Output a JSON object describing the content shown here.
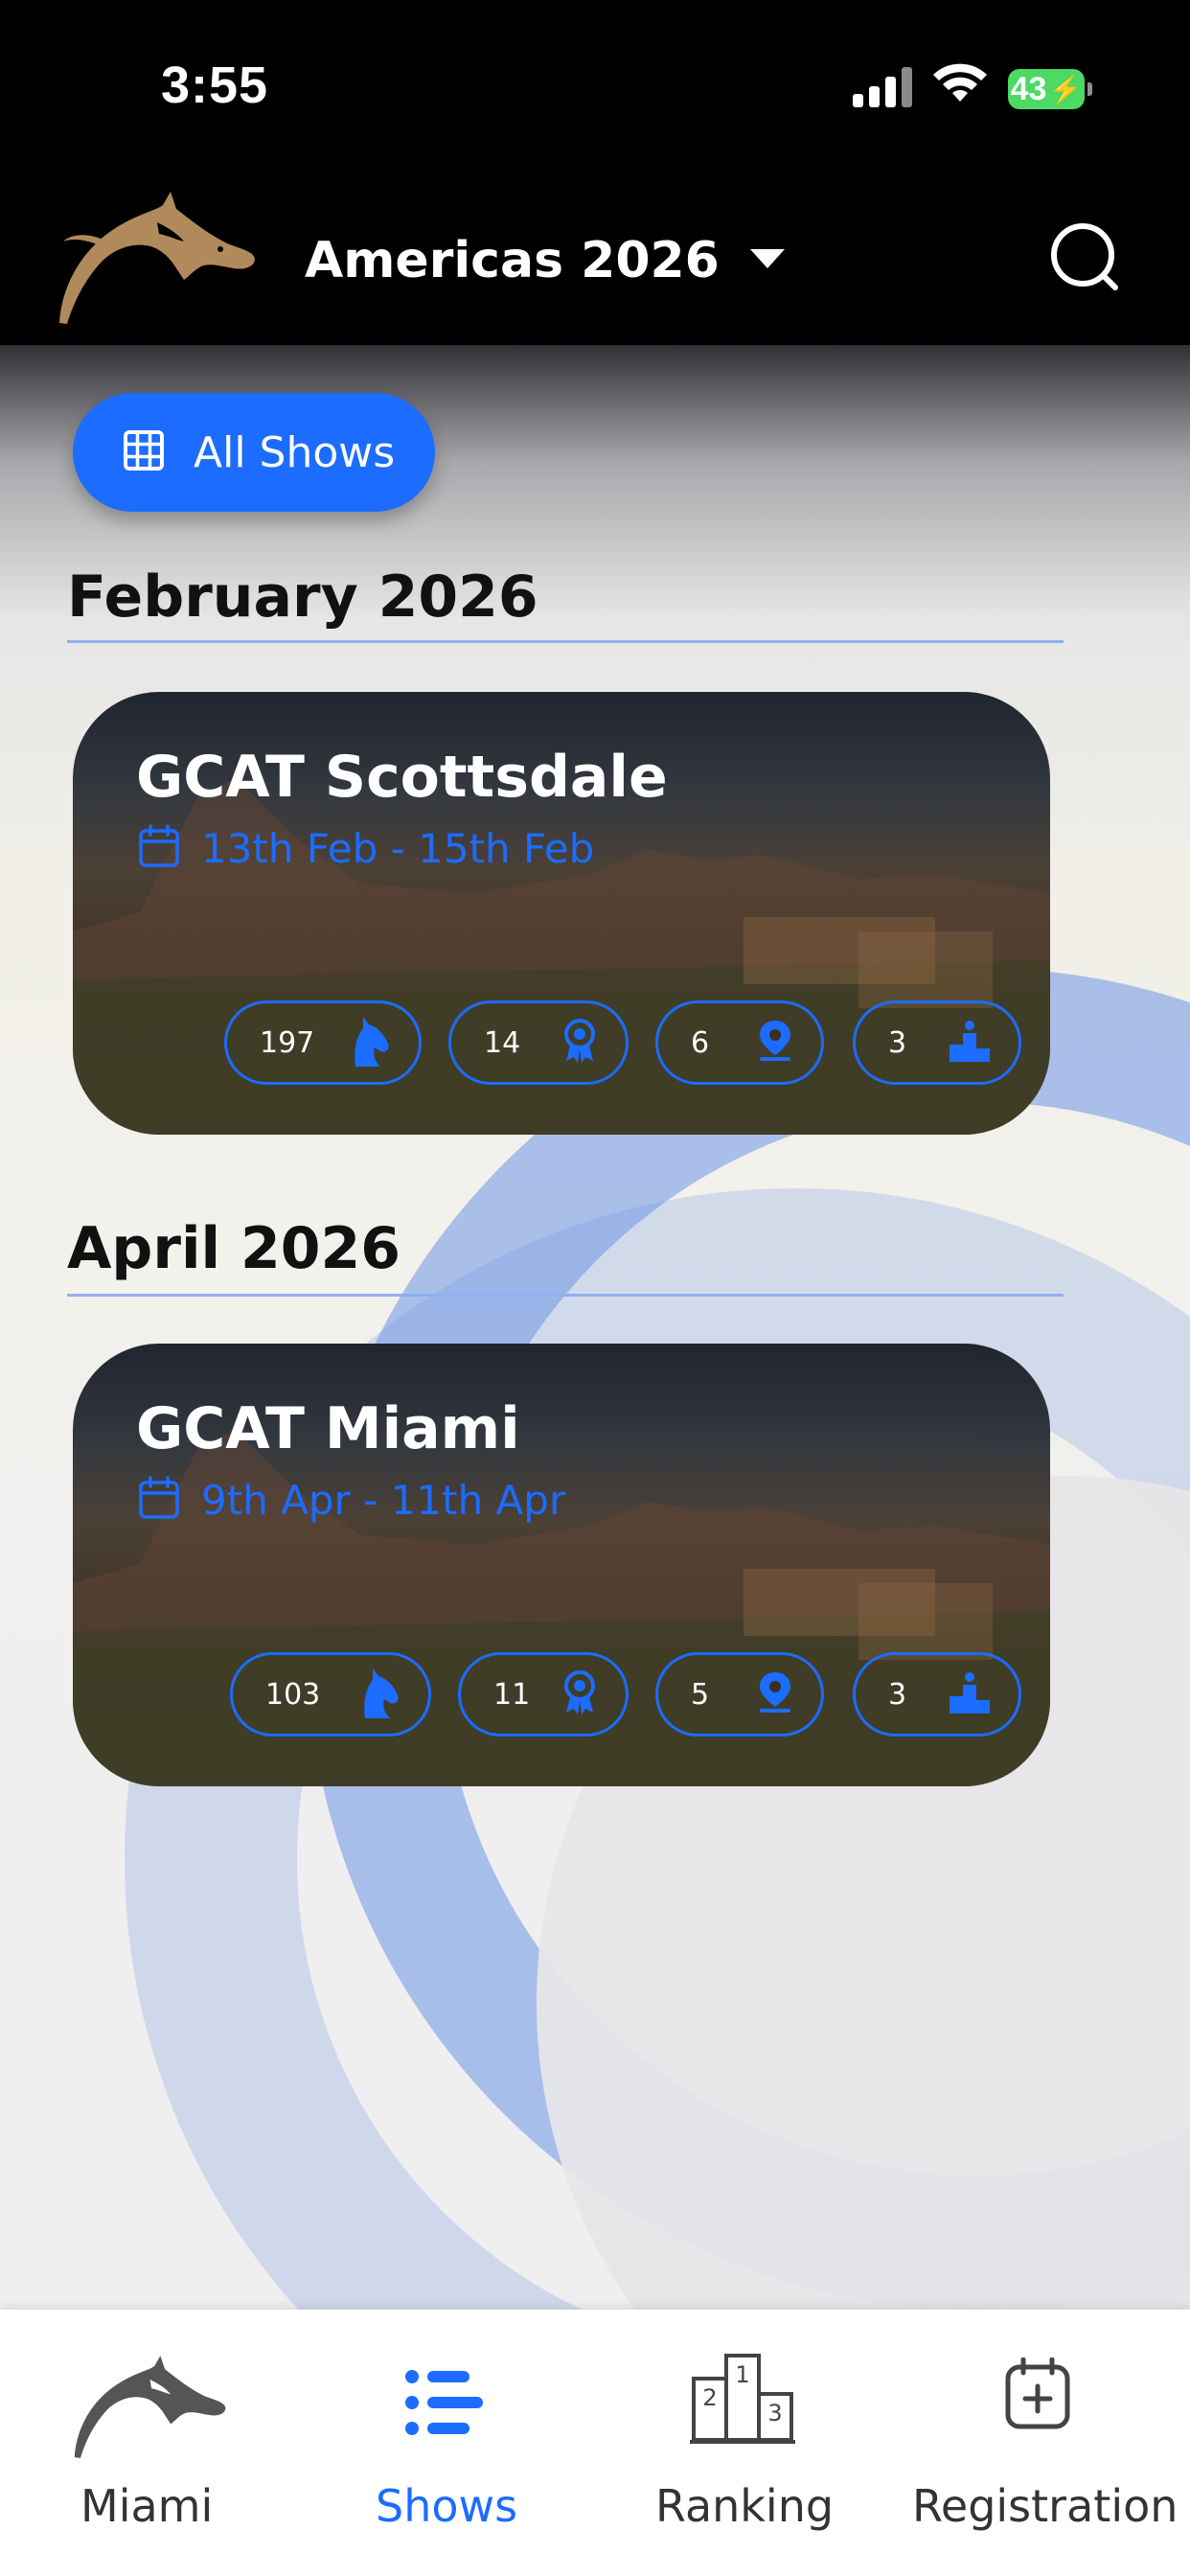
{
  "status_bar": {
    "time": "3:55",
    "battery": "43"
  },
  "header": {
    "region": "Americas 2026",
    "icons": [
      "horse-logo-icon",
      "chevron-down-icon",
      "search-icon"
    ]
  },
  "filter": {
    "all_shows_label": "All Shows",
    "icon": "grid-icon"
  },
  "sections": [
    {
      "month": "February 2026",
      "show": {
        "title": "GCAT Scottsdale",
        "dates": "13th Feb - 15th Feb",
        "stats": {
          "horses": "197",
          "awards": "14",
          "locations": "6",
          "podiums": "3"
        }
      }
    },
    {
      "month": "April 2026",
      "show": {
        "title": "GCAT Miami",
        "dates": "9th Apr - 11th Apr",
        "stats": {
          "horses": "103",
          "awards": "11",
          "locations": "5",
          "podiums": "3"
        }
      }
    }
  ],
  "tabbar": {
    "tabs": [
      {
        "label": "Miami",
        "icon": "horse-head-icon",
        "active": false
      },
      {
        "label": "Shows",
        "icon": "list-icon",
        "active": true
      },
      {
        "label": "Ranking",
        "icon": "podium-icon",
        "active": false
      },
      {
        "label": "Registration",
        "icon": "calendar-plus-icon",
        "active": false
      }
    ]
  },
  "colors": {
    "accent": "#1c6cff",
    "header_bg": "#000000",
    "logo_gold": "#b08a5a"
  }
}
